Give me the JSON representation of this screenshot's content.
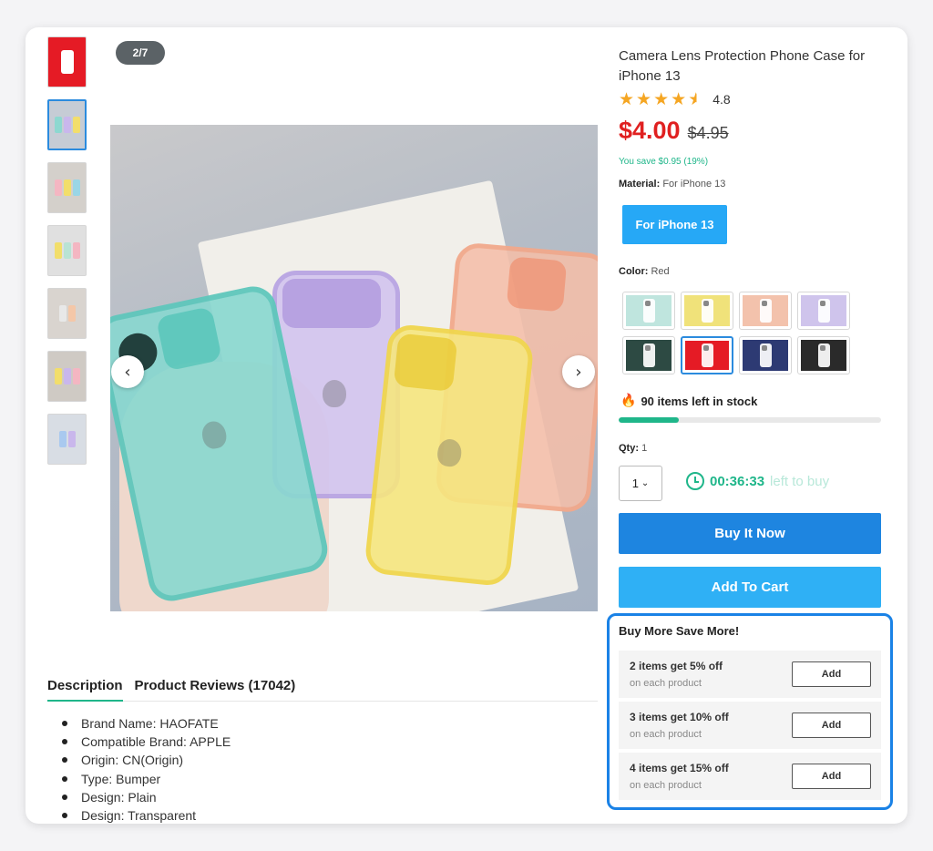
{
  "gallery": {
    "counter": "2/7",
    "thumbnails": [
      "thumb-red",
      "thumb-mixed-1",
      "thumb-mixed-2",
      "thumb-mixed-3",
      "thumb-mixed-4",
      "thumb-mixed-5",
      "thumb-mixed-6"
    ],
    "prev_icon": "chevron-left-icon",
    "next_icon": "chevron-right-icon"
  },
  "product": {
    "title": "Camera Lens Protection Phone Case for iPhone 13",
    "rating_value": "4.8",
    "rating_stars": 4.5,
    "price": "$4.00",
    "original_price": "$4.95",
    "save_text": "You save $0.95 (19%)",
    "material_label": "Material:",
    "material_value": "For iPhone 13",
    "variant_button": "For iPhone 13",
    "color_label": "Color:",
    "color_value": "Red",
    "colors": [
      "#bfe5de",
      "#f0e27a",
      "#f3c2ac",
      "#cfc4ec",
      "#2d4a43",
      "#e51b25",
      "#2d3a73",
      "#2a2a2a"
    ],
    "selected_color_index": 5,
    "stock_text": "90 items left in stock",
    "stock_fraction": 0.23,
    "qty_label": "Qty:",
    "qty_value": "1",
    "qty_select_value": "1",
    "timer_value": "00:36:33",
    "timer_text": "left to buy",
    "buy_now": "Buy It Now",
    "add_to_cart": "Add To Cart"
  },
  "bundle": {
    "title": "Buy More Save More!",
    "offers": [
      {
        "main": "2 items get 5% off",
        "sub": "on each product",
        "button": "Add"
      },
      {
        "main": "3 items get 10% off",
        "sub": "on each product",
        "button": "Add"
      },
      {
        "main": "4 items get 15% off",
        "sub": "on each product",
        "button": "Add"
      }
    ]
  },
  "tabs": {
    "description": "Description",
    "reviews": "Product Reviews (17042)"
  },
  "description_items": [
    "Brand Name: HAOFATE",
    "Compatible Brand: APPLE",
    "Origin: CN(Origin)",
    "Type: Bumper",
    "Design: Plain",
    "Design: Transparent"
  ],
  "colors": {
    "accent_blue": "#1e85e0",
    "light_blue": "#2fb0f5",
    "price_red": "#e02020",
    "green": "#1fb68a",
    "star": "#f5a623"
  }
}
